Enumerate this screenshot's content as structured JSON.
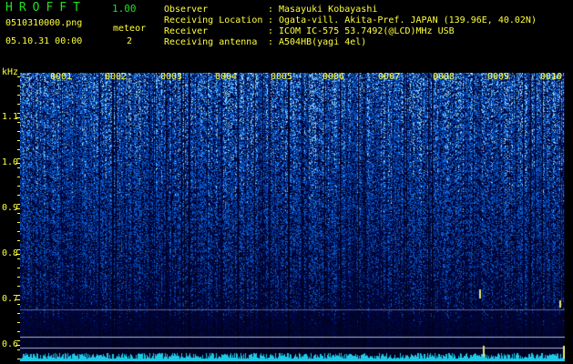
{
  "header": {
    "app_title": "HROFFT",
    "version": "1.00",
    "file_name": "0510310000.png",
    "meteor_label": "meteor",
    "meteor_count": "2",
    "timestamp": "05.10.31 00:00"
  },
  "info": {
    "observer_label": "Observer",
    "observer_value": "Masayuki Kobayashi",
    "location_label": "Receiving Location",
    "location_value": "Ogata-vill. Akita-Pref. JAPAN (139.96E, 40.02N)",
    "receiver_label": "Receiver",
    "receiver_value": "ICOM IC-575 53.7492(@LCD)MHz USB",
    "antenna_label": "Receiving antenna",
    "antenna_value": "A504HB(yagi 4el)",
    "sep": ":"
  },
  "axis": {
    "unit": "kHz",
    "y_ticks": [
      "1.1",
      "1.0",
      "0.9",
      "0.8",
      "0.7",
      "0.6"
    ],
    "minute_labels": [
      "0001",
      "0002",
      "0003",
      "0004",
      "0005",
      "0006",
      "0007",
      "0008",
      "0009",
      "0010"
    ]
  },
  "colors": {
    "text": "#ffff3c",
    "title": "#22e022",
    "spectrum_low": "#000814",
    "spectrum_high": "#3aa0ff",
    "signal_trace": "#1ec8e6"
  }
}
